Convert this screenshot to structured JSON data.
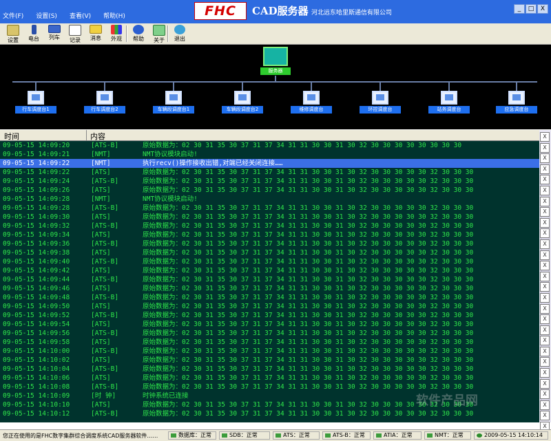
{
  "app": {
    "logo": "FHC",
    "title": "CAD服务器",
    "company": "河北远东哈里斯通信有限公司"
  },
  "menu": [
    "文件(F)",
    "设置(S)",
    "查看(V)",
    "帮助(H)"
  ],
  "window_buttons": [
    "_",
    "□",
    "X"
  ],
  "toolbar": [
    {
      "label": "设置",
      "icon": "settings-icon"
    },
    {
      "label": "电台",
      "icon": "radio-icon"
    },
    {
      "label": "列车",
      "icon": "train-icon"
    },
    {
      "label": "记录",
      "icon": "record-icon"
    },
    {
      "label": "消息",
      "icon": "message-icon"
    },
    {
      "label": "外观",
      "icon": "appearance-icon"
    },
    {
      "label": "帮助",
      "icon": "help-icon"
    },
    {
      "label": "关于",
      "icon": "about-icon"
    },
    {
      "label": "退出",
      "icon": "exit-icon"
    }
  ],
  "topology": {
    "server_label": "服务器",
    "nodes": [
      "行车调度台1",
      "行车调度台2",
      "车辆段调度台1",
      "车辆段调度台2",
      "维修调度台",
      "环控调度台",
      "站务调度台",
      "应急调度台"
    ]
  },
  "log": {
    "headers": {
      "time": "时间",
      "content": "内容"
    },
    "rows": [
      {
        "time": "09-05-15 14:09:20",
        "source": "[ATS-B]",
        "msg": "原始数据为：02 30 31 35 30 37 31 37 34 31 31 30 30 31 30 32 30 30 30 30 30 30 30 30"
      },
      {
        "time": "09-05-15 14:09:21",
        "source": "[NMT]",
        "msg": "NMT协议模块启动!"
      },
      {
        "time": "09-05-15 14:09:22",
        "source": "[NMT]",
        "msg": "执行recv()操作接收出错,对端已经关闭连接……",
        "selected": true
      },
      {
        "time": "09-05-15 14:09:22",
        "source": "[ATS]",
        "msg": "原始数据为：02 30 31 35 30 37 31 37 34 31 31 30 30 31 30 32 30 30 30 30 30 32 30 30 30"
      },
      {
        "time": "09-05-15 14:09:24",
        "source": "[ATS-B]",
        "msg": "原始数据为：02 30 31 35 30 37 31 37 34 31 31 30 30 31 30 32 30 30 30 30 30 32 30 30 30"
      },
      {
        "time": "09-05-15 14:09:26",
        "source": "[ATS]",
        "msg": "原始数据为：02 30 31 35 30 37 31 37 34 31 31 30 30 31 30 32 30 30 30 30 30 32 30 30 30"
      },
      {
        "time": "09-05-15 14:09:28",
        "source": "[NMT]",
        "msg": "NMT协议模块启动!"
      },
      {
        "time": "09-05-15 14:09:28",
        "source": "[ATS-B]",
        "msg": "原始数据为：02 30 31 35 30 37 31 37 34 31 31 30 30 31 30 32 30 30 30 30 30 32 30 30 30"
      },
      {
        "time": "09-05-15 14:09:30",
        "source": "[ATS]",
        "msg": "原始数据为：02 30 31 35 30 37 31 37 34 31 31 30 30 31 30 32 30 30 30 30 30 32 30 30 30"
      },
      {
        "time": "09-05-15 14:09:32",
        "source": "[ATS-B]",
        "msg": "原始数据为：02 30 31 35 30 37 31 37 34 31 31 30 30 31 30 32 30 30 30 30 30 32 30 30 30"
      },
      {
        "time": "09-05-15 14:09:34",
        "source": "[ATS]",
        "msg": "原始数据为：02 30 31 35 30 37 31 37 34 31 31 30 30 31 30 32 30 30 30 30 30 32 30 30 30"
      },
      {
        "time": "09-05-15 14:09:36",
        "source": "[ATS-B]",
        "msg": "原始数据为：02 30 31 35 30 37 31 37 34 31 31 30 30 31 30 32 30 30 30 30 30 32 30 30 30"
      },
      {
        "time": "09-05-15 14:09:38",
        "source": "[ATS]",
        "msg": "原始数据为：02 30 31 35 30 37 31 37 34 31 31 30 30 31 30 32 30 30 30 30 30 32 30 30 30"
      },
      {
        "time": "09-05-15 14:09:40",
        "source": "[ATS-B]",
        "msg": "原始数据为：02 30 31 35 30 37 31 37 34 31 31 30 30 31 30 32 30 30 30 30 30 32 30 30 30"
      },
      {
        "time": "09-05-15 14:09:42",
        "source": "[ATS]",
        "msg": "原始数据为：02 30 31 35 30 37 31 37 34 31 31 30 30 31 30 32 30 30 30 30 30 32 30 30 30"
      },
      {
        "time": "09-05-15 14:09:44",
        "source": "[ATS-B]",
        "msg": "原始数据为：02 30 31 35 30 37 31 37 34 31 31 30 30 31 30 32 30 30 30 30 30 32 30 30 30"
      },
      {
        "time": "09-05-15 14:09:46",
        "source": "[ATS]",
        "msg": "原始数据为：02 30 31 35 30 37 31 37 34 31 31 30 30 31 30 32 30 30 30 30 30 32 30 30 30"
      },
      {
        "time": "09-05-15 14:09:48",
        "source": "[ATS-B]",
        "msg": "原始数据为：02 30 31 35 30 37 31 37 34 31 31 30 30 31 30 32 30 30 30 30 30 32 30 30 30"
      },
      {
        "time": "09-05-15 14:09:50",
        "source": "[ATS]",
        "msg": "原始数据为：02 30 31 35 30 37 31 37 34 31 31 30 30 31 30 32 30 30 30 30 30 32 30 30 30"
      },
      {
        "time": "09-05-15 14:09:52",
        "source": "[ATS-B]",
        "msg": "原始数据为：02 30 31 35 30 37 31 37 34 31 31 30 30 31 30 32 30 30 30 30 30 32 30 30 30"
      },
      {
        "time": "09-05-15 14:09:54",
        "source": "[ATS]",
        "msg": "原始数据为：02 30 31 35 30 37 31 37 34 31 31 30 30 31 30 32 30 30 30 30 30 32 30 30 30"
      },
      {
        "time": "09-05-15 14:09:56",
        "source": "[ATS-B]",
        "msg": "原始数据为：02 30 31 35 30 37 31 37 34 31 31 30 30 31 30 32 30 30 30 30 30 32 30 30 30"
      },
      {
        "time": "09-05-15 14:09:58",
        "source": "[ATS]",
        "msg": "原始数据为：02 30 31 35 30 37 31 37 34 31 31 30 30 31 30 32 30 30 30 30 30 32 30 30 30"
      },
      {
        "time": "09-05-15 14:10:00",
        "source": "[ATS-B]",
        "msg": "原始数据为：02 30 31 35 30 37 31 37 34 31 31 30 30 31 30 32 30 30 30 30 30 32 30 30 30"
      },
      {
        "time": "09-05-15 14:10:02",
        "source": "[ATS]",
        "msg": "原始数据为：02 30 31 35 30 37 31 37 34 31 31 30 30 31 30 32 30 30 30 30 30 32 30 30 30"
      },
      {
        "time": "09-05-15 14:10:04",
        "source": "[ATS-B]",
        "msg": "原始数据为：02 30 31 35 30 37 31 37 34 31 31 30 30 31 30 32 30 30 30 30 30 32 30 30 30"
      },
      {
        "time": "09-05-15 14:10:06",
        "source": "[ATS]",
        "msg": "原始数据为：02 30 31 35 30 37 31 37 34 31 31 30 30 31 30 32 30 30 30 30 30 32 30 30 30"
      },
      {
        "time": "09-05-15 14:10:08",
        "source": "[ATS-B]",
        "msg": "原始数据为：02 30 31 35 30 37 31 37 34 31 31 30 30 31 30 32 30 30 30 30 30 32 30 30 30"
      },
      {
        "time": "09-05-15 14:10:09",
        "source": "[时 钟]",
        "msg": "时钟系统已连接"
      },
      {
        "time": "09-05-15 14:10:10",
        "source": "[ATS]",
        "msg": "原始数据为：02 30 31 35 30 37 31 37 34 31 31 30 30 31 30 32 30 30 30 30 30 32 30 30 30"
      },
      {
        "time": "09-05-15 14:10:12",
        "source": "[ATS-B]",
        "msg": "原始数据为：02 30 31 35 30 37 31 37 34 31 31 30 30 31 30 32 30 30 30 30 30 32 30 30 30"
      }
    ]
  },
  "status": {
    "message": "您正在使用的是FHC数字集群综合调度系统CAD服务器软件……",
    "items": [
      "数据库：正常",
      "SDB：正常",
      "ATS：正常",
      "ATS-B：正常",
      "ATIA：正常",
      "NMT：正常"
    ],
    "clock": "2009-05-15 14:10:14"
  },
  "watermark": "软件产品网",
  "colors": {
    "title_bar": "#2d6be0",
    "log_bg": "#00332d",
    "log_text": "#2ee64a",
    "selected_row": "#3b6fe6",
    "node_label": "#1e6ff0",
    "server_label": "#2ecc2e"
  }
}
